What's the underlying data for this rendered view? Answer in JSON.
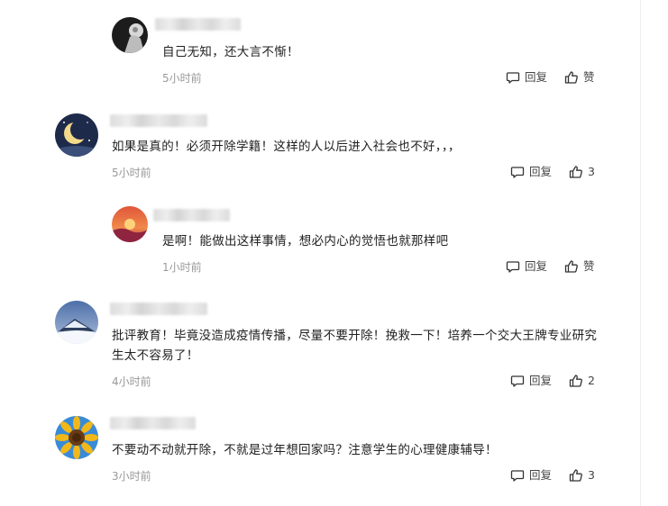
{
  "reply_icon": "comment-bubble-icon",
  "like_icon": "thumbs-up-icon",
  "comments": [
    {
      "text": "自己无知，还大言不惭！",
      "time": "5小时前",
      "reply_label": "回复",
      "like_label": "赞"
    },
    {
      "text": "如果是真的！必须开除学籍！这样的人以后进入社会也不好，，，",
      "time": "5小时前",
      "reply_label": "回复",
      "like_label": "3"
    },
    {
      "text": "是啊！能做出这样事情，想必内心的觉悟也就那样吧",
      "time": "1小时前",
      "reply_label": "回复",
      "like_label": "赞"
    },
    {
      "text": "批评教育！毕竟没造成疫情传播，尽量不要开除！挽救一下！培养一个交大王牌专业研究生太不容易了！",
      "time": "4小时前",
      "reply_label": "回复",
      "like_label": "2"
    },
    {
      "text": "不要动不动就开除，不就是过年想回家吗？注意学生的心理健康辅导！",
      "time": "3小时前",
      "reply_label": "回复",
      "like_label": "3"
    }
  ]
}
